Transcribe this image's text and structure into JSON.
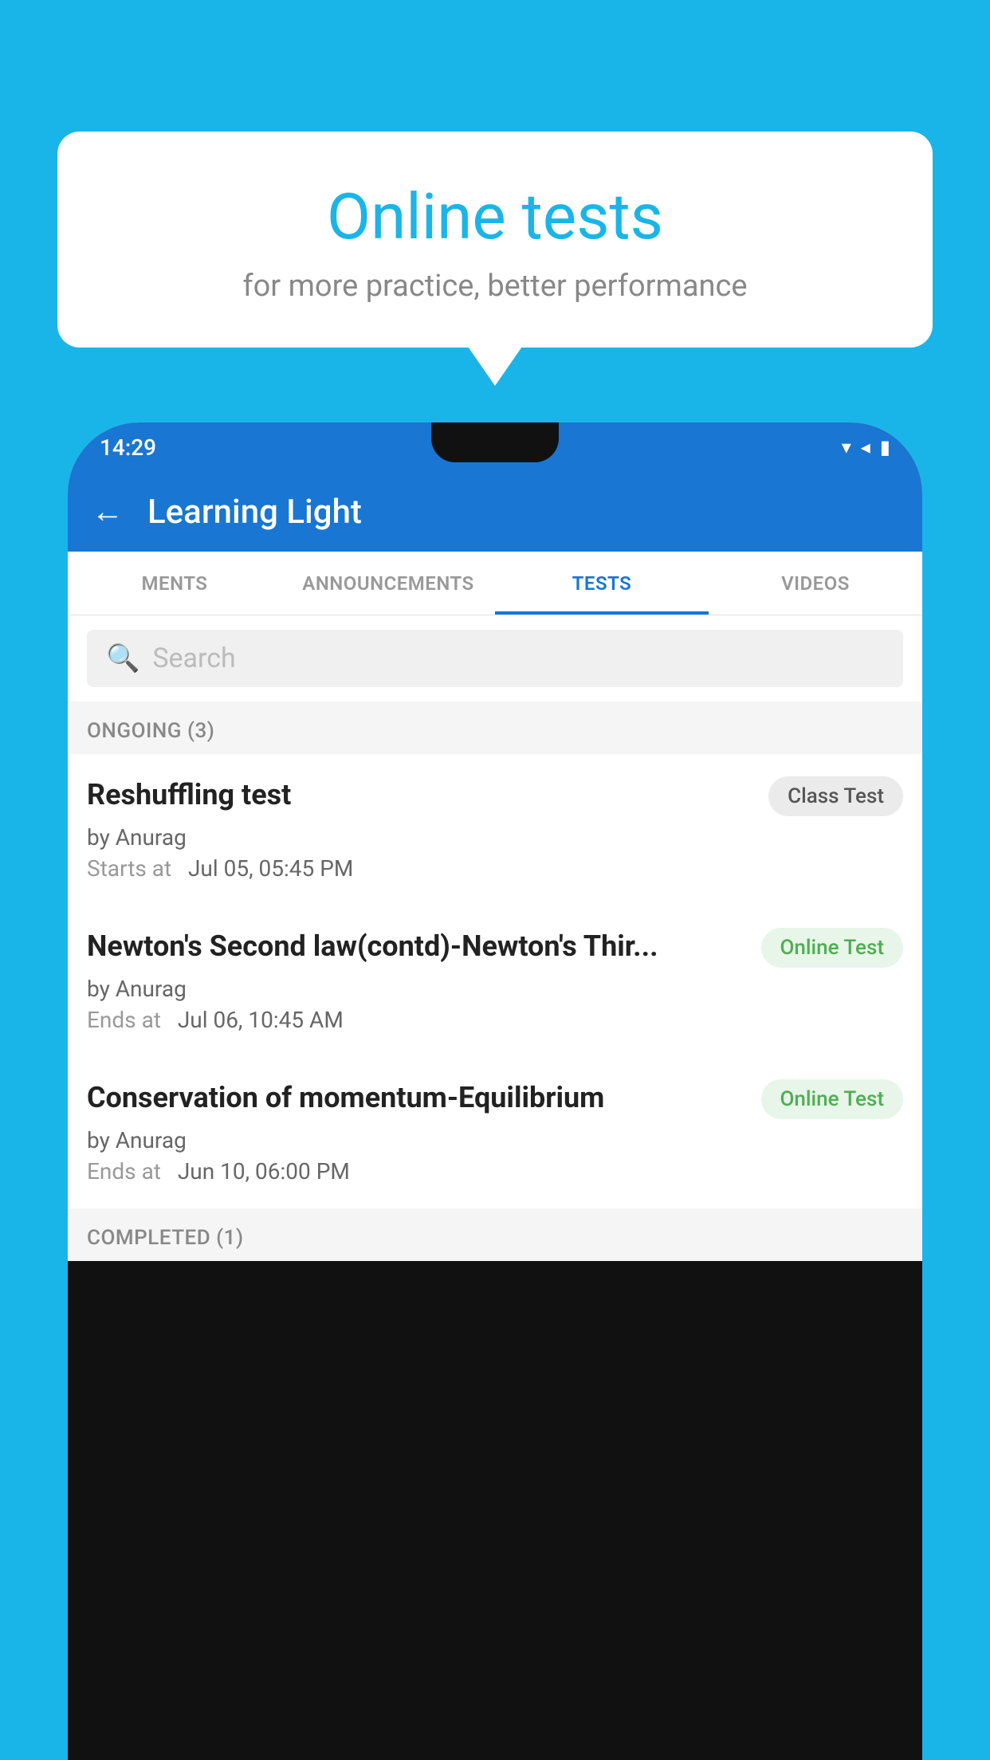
{
  "background_color": "#1ab5e8",
  "bubble": {
    "title": "Online tests",
    "subtitle": "for more practice, better performance"
  },
  "phone": {
    "status_bar": {
      "time": "14:29",
      "icons": "▾◂▮"
    },
    "header": {
      "back_label": "←",
      "title": "Learning Light"
    },
    "tabs": [
      {
        "label": "MENTS",
        "active": false
      },
      {
        "label": "ANNOUNCEMENTS",
        "active": false
      },
      {
        "label": "TESTS",
        "active": true
      },
      {
        "label": "VIDEOS",
        "active": false
      }
    ],
    "search": {
      "placeholder": "Search"
    },
    "ongoing_section": {
      "label": "ONGOING (3)"
    },
    "tests": [
      {
        "title": "Reshuffling test",
        "badge": "Class Test",
        "badge_type": "class",
        "by": "by Anurag",
        "date_label": "Starts at",
        "date": "Jul 05, 05:45 PM"
      },
      {
        "title": "Newton's Second law(contd)-Newton's Thir...",
        "badge": "Online Test",
        "badge_type": "online",
        "by": "by Anurag",
        "date_label": "Ends at",
        "date": "Jul 06, 10:45 AM"
      },
      {
        "title": "Conservation of momentum-Equilibrium",
        "badge": "Online Test",
        "badge_type": "online",
        "by": "by Anurag",
        "date_label": "Ends at",
        "date": "Jun 10, 06:00 PM"
      }
    ],
    "completed_section": {
      "label": "COMPLETED (1)"
    }
  }
}
